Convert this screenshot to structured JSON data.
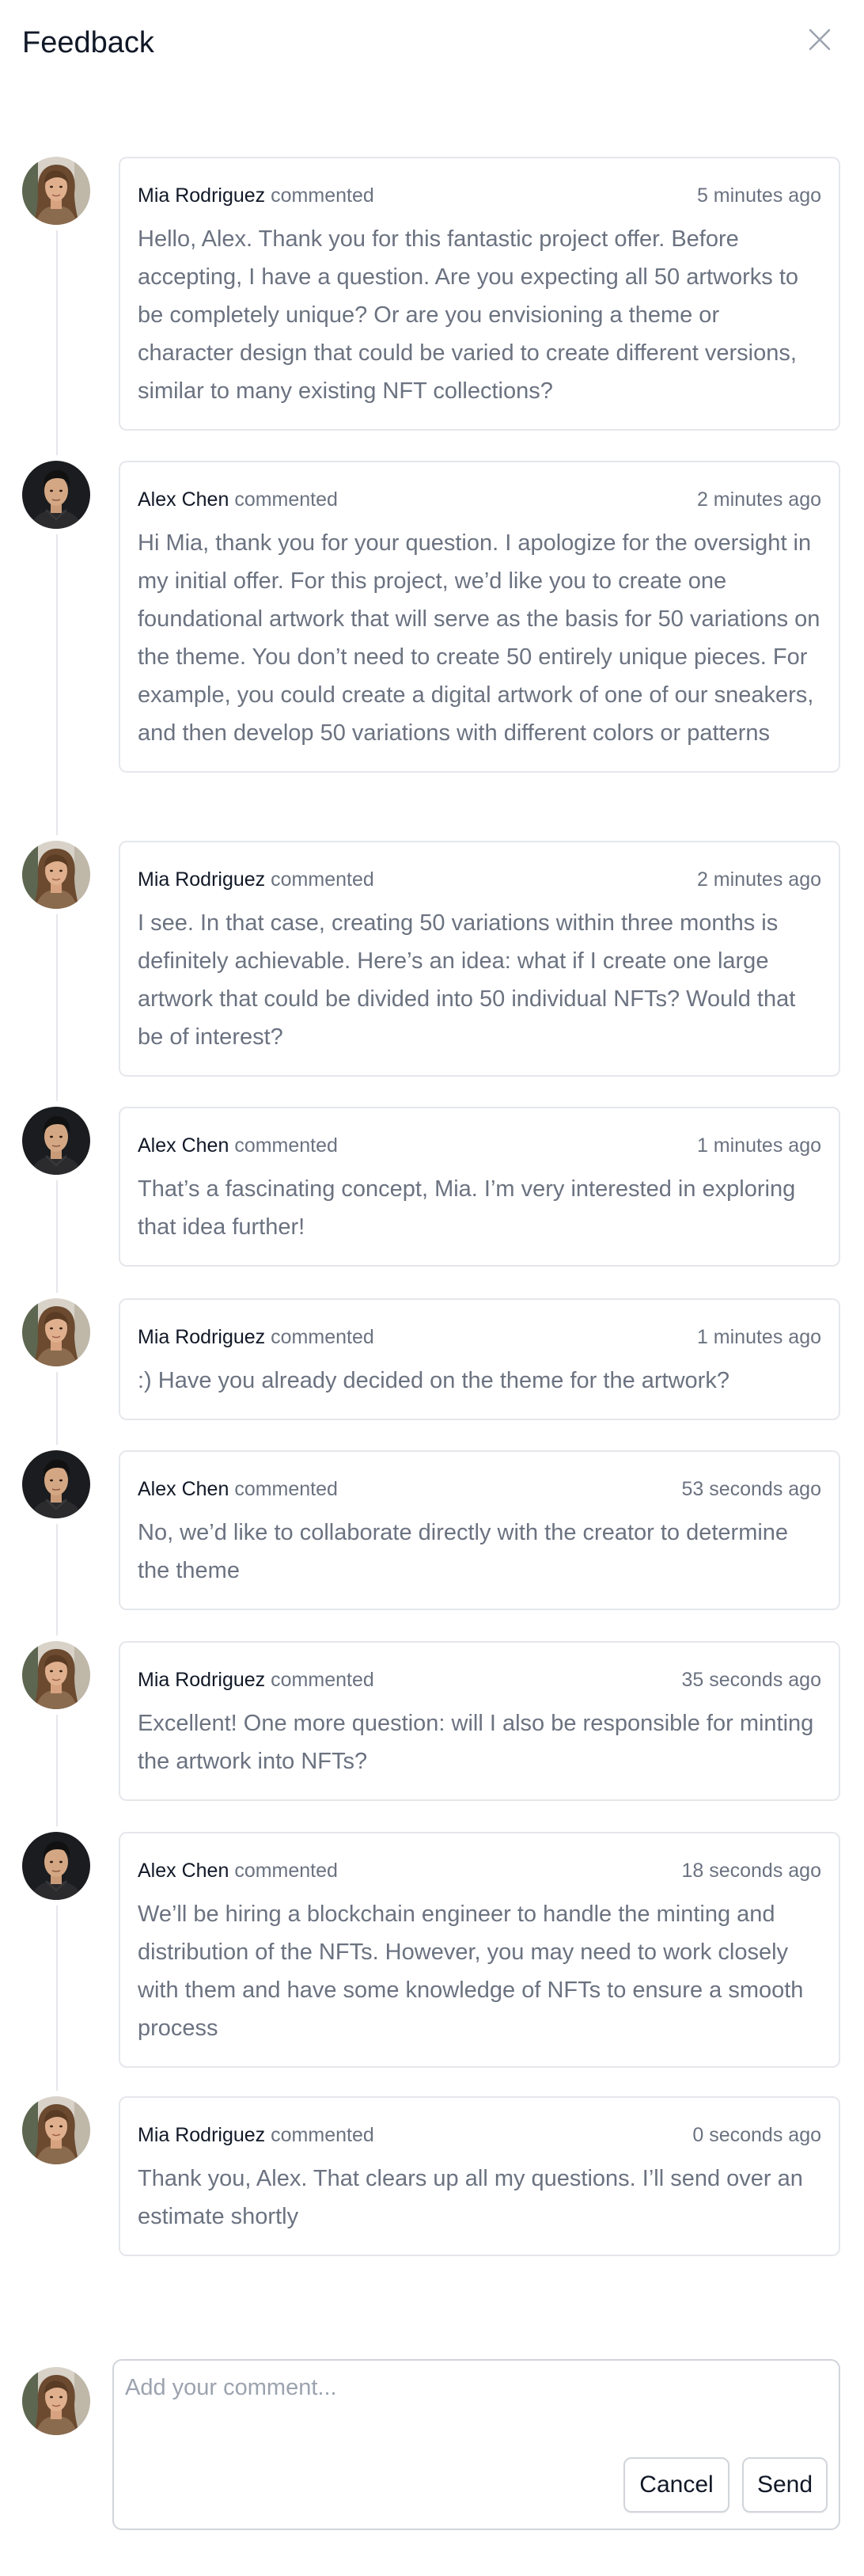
{
  "header": {
    "title": "Feedback"
  },
  "verb": "commented",
  "comments": [
    {
      "author": "Mia Rodriguez",
      "avatar": "mia",
      "time": "5 minutes ago",
      "text": "Hello, Alex. Thank you for this fantastic project offer. Before accepting, I have a question. Are you expecting all 50 artworks to be completely unique? Or are you envisioning a theme or character design that could be varied to create different versions, similar to many existing NFT collections?"
    },
    {
      "author": "Alex Chen",
      "avatar": "alex",
      "time": "2 minutes ago",
      "text": "Hi Mia, thank you for your question. I apologize for the oversight in my initial offer. For this project, we’d like you to create one foundational artwork that will serve as the basis for 50 variations on the theme. You don’t need to create 50 entirely unique pieces. For example, you could create a digital artwork of one of our sneakers, and then develop 50 variations with different colors or patterns"
    },
    {
      "author": "Mia Rodriguez",
      "avatar": "mia",
      "time": "2 minutes ago",
      "text": "I see. In that case, creating 50 variations within three months is definitely achievable. Here’s an idea: what if I create one large artwork that could be divided into 50 individual NFTs? Would that be of interest?"
    },
    {
      "author": "Alex Chen",
      "avatar": "alex",
      "time": "1 minutes ago",
      "text": "That’s a fascinating concept, Mia. I’m very interested in exploring that idea further!"
    },
    {
      "author": "Mia Rodriguez",
      "avatar": "mia",
      "time": "1 minutes ago",
      "text": ":) Have you already decided on the theme for the artwork?"
    },
    {
      "author": "Alex Chen",
      "avatar": "alex",
      "time": "53 seconds ago",
      "text": "No, we’d like to collaborate directly with the creator to determine the theme"
    },
    {
      "author": "Mia Rodriguez",
      "avatar": "mia",
      "time": "35 seconds ago",
      "text": "Excellent! One more question: will I also be responsible for minting the artwork into NFTs?"
    },
    {
      "author": "Alex Chen",
      "avatar": "alex",
      "time": "18 seconds ago",
      "text": "We’ll be hiring a blockchain engineer to handle the minting and distribution of the NFTs. However, you may need to work closely with them and have some knowledge of NFTs to ensure a smooth process"
    },
    {
      "author": "Mia Rodriguez",
      "avatar": "mia",
      "time": "0 seconds ago",
      "text": "Thank you, Alex. That clears up all my questions. I’ll send over an estimate shortly"
    }
  ],
  "composer": {
    "placeholder": "Add your comment...",
    "cancel_label": "Cancel",
    "send_label": "Send"
  }
}
